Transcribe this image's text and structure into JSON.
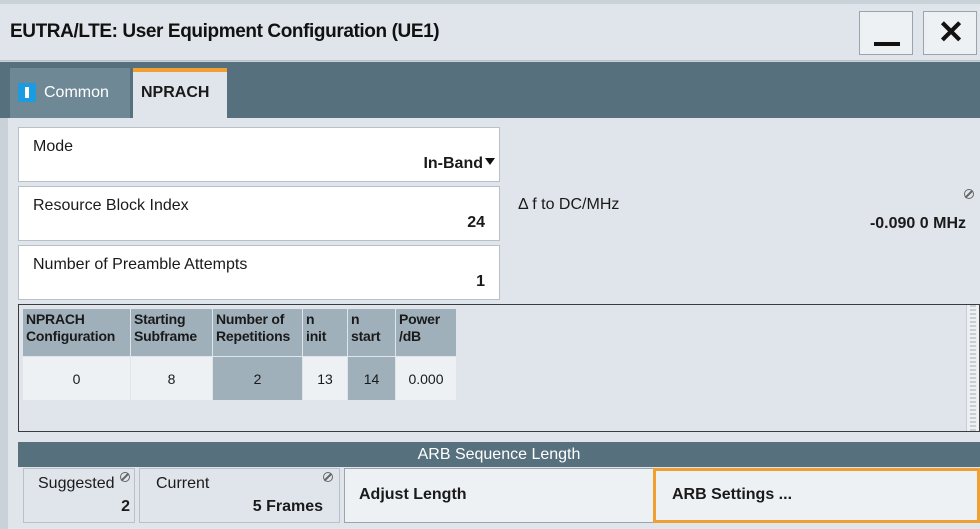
{
  "window": {
    "title": "EUTRA/LTE: User Equipment Configuration (UE1)",
    "minimize_icon": "minimize-icon",
    "close_label": "✕"
  },
  "tabs": [
    {
      "label": "Common",
      "icon": "info-badge-icon",
      "active": false
    },
    {
      "label": "NPRACH",
      "active": true
    }
  ],
  "fields": {
    "mode": {
      "label": "Mode",
      "value": "In-Band"
    },
    "resource_block_index": {
      "label": "Resource Block Index",
      "value": "24"
    },
    "delta_f": {
      "label": "Δ f to DC/MHz",
      "value": "-0.090 0 MHz"
    },
    "preamble_attempts": {
      "label": "Number of Preamble Attempts",
      "value": "1"
    }
  },
  "table": {
    "headers": [
      [
        "NPRACH",
        "Configuration"
      ],
      [
        "Starting",
        "Subframe"
      ],
      [
        "Number of",
        "Repetitions"
      ],
      [
        "n",
        "init"
      ],
      [
        "n",
        "start"
      ],
      [
        "Power",
        "/dB"
      ]
    ],
    "rows": [
      [
        "0",
        "8",
        "2",
        "13",
        "14",
        "0.000"
      ]
    ]
  },
  "arb": {
    "section_title": "ARB Sequence Length",
    "suggested": {
      "label": "Suggested",
      "value": "2"
    },
    "current": {
      "label": "Current",
      "value": "5 Frames"
    },
    "adjust_button": "Adjust Length",
    "settings_button": "ARB Settings ..."
  },
  "colors": {
    "tab_strip": "#56707d",
    "accent_orange": "#f0a030",
    "info_blue": "#1b9be0",
    "panel": "#dfe5ea",
    "table_header": "#9fb0bb"
  }
}
